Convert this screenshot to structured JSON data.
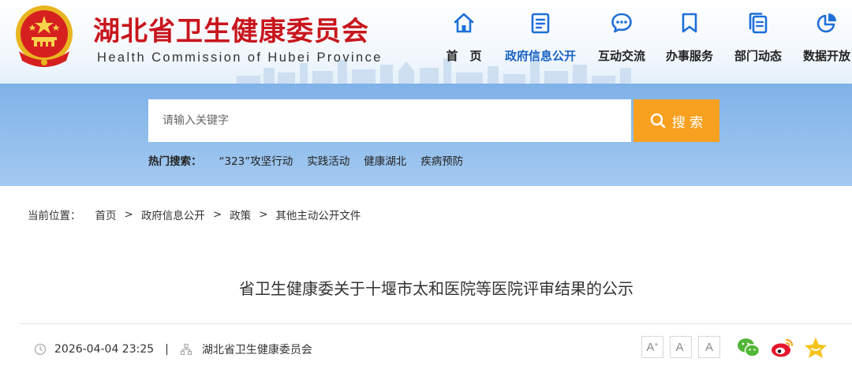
{
  "header": {
    "title": "湖北省卫生健康委员会",
    "subtitle": "Health Commission of Hubei Province",
    "emblem_icon": "national-emblem-icon"
  },
  "nav": {
    "items": [
      {
        "label": "首　页",
        "icon": "home-icon",
        "active": false
      },
      {
        "label": "政府信息公开",
        "icon": "document-list-icon",
        "active": true
      },
      {
        "label": "互动交流",
        "icon": "chat-bubble-icon",
        "active": false
      },
      {
        "label": "办事服务",
        "icon": "bookmark-icon",
        "active": false
      },
      {
        "label": "部门动态",
        "icon": "copy-document-icon",
        "active": false
      },
      {
        "label": "数据开放",
        "icon": "pie-chart-icon",
        "active": false
      }
    ]
  },
  "search": {
    "placeholder": "请输入关键字",
    "button_label": "搜 索",
    "hot_label": "热门搜索：",
    "hot_items": [
      "“323”攻坚行动",
      "实践活动",
      "健康湖北",
      "疾病预防"
    ]
  },
  "breadcrumb": {
    "label": "当前位置：",
    "items": [
      "首页",
      "政府信息公开",
      "政策",
      "其他主动公开文件"
    ],
    "separator": ">"
  },
  "article": {
    "title": "省卫生健康委关于十堰市太和医院等医院评审结果的公示",
    "datetime": "2026-04-04 23:25",
    "meta_separator": "|",
    "source": "湖北省卫生健康委员会"
  },
  "tools": {
    "font_buttons": [
      "A",
      "A",
      "A"
    ],
    "share_icons": [
      "wechat-icon",
      "weibo-icon",
      "favorite-star-icon"
    ]
  },
  "colors": {
    "brand_red": "#c8161d",
    "nav_active": "#1a63c3",
    "icon_blue": "#1e6fd9",
    "search_band": "#8fbbeb",
    "search_button": "#f8a01f"
  }
}
